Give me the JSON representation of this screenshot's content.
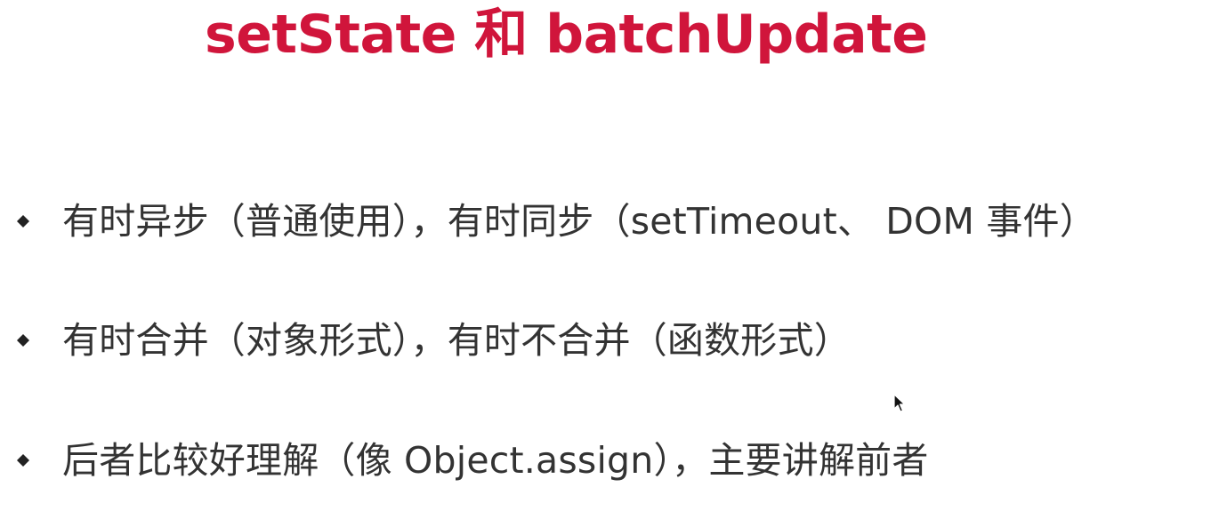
{
  "slide": {
    "title": "setState 和 batchUpdate",
    "bullets": [
      {
        "text": "有时异步（普通使用），有时同步（setTimeout、 DOM 事件）"
      },
      {
        "text": "有时合并（对象形式），有时不合并（函数形式）"
      },
      {
        "text": "后者比较好理解（像 Object.assign），主要讲解前者"
      }
    ]
  },
  "icons": {
    "bullet": "diamond-bullet-icon",
    "cursor": "mouse-pointer-icon"
  },
  "colors": {
    "title": "#d0153b",
    "body_text": "#333333",
    "background": "#ffffff"
  }
}
